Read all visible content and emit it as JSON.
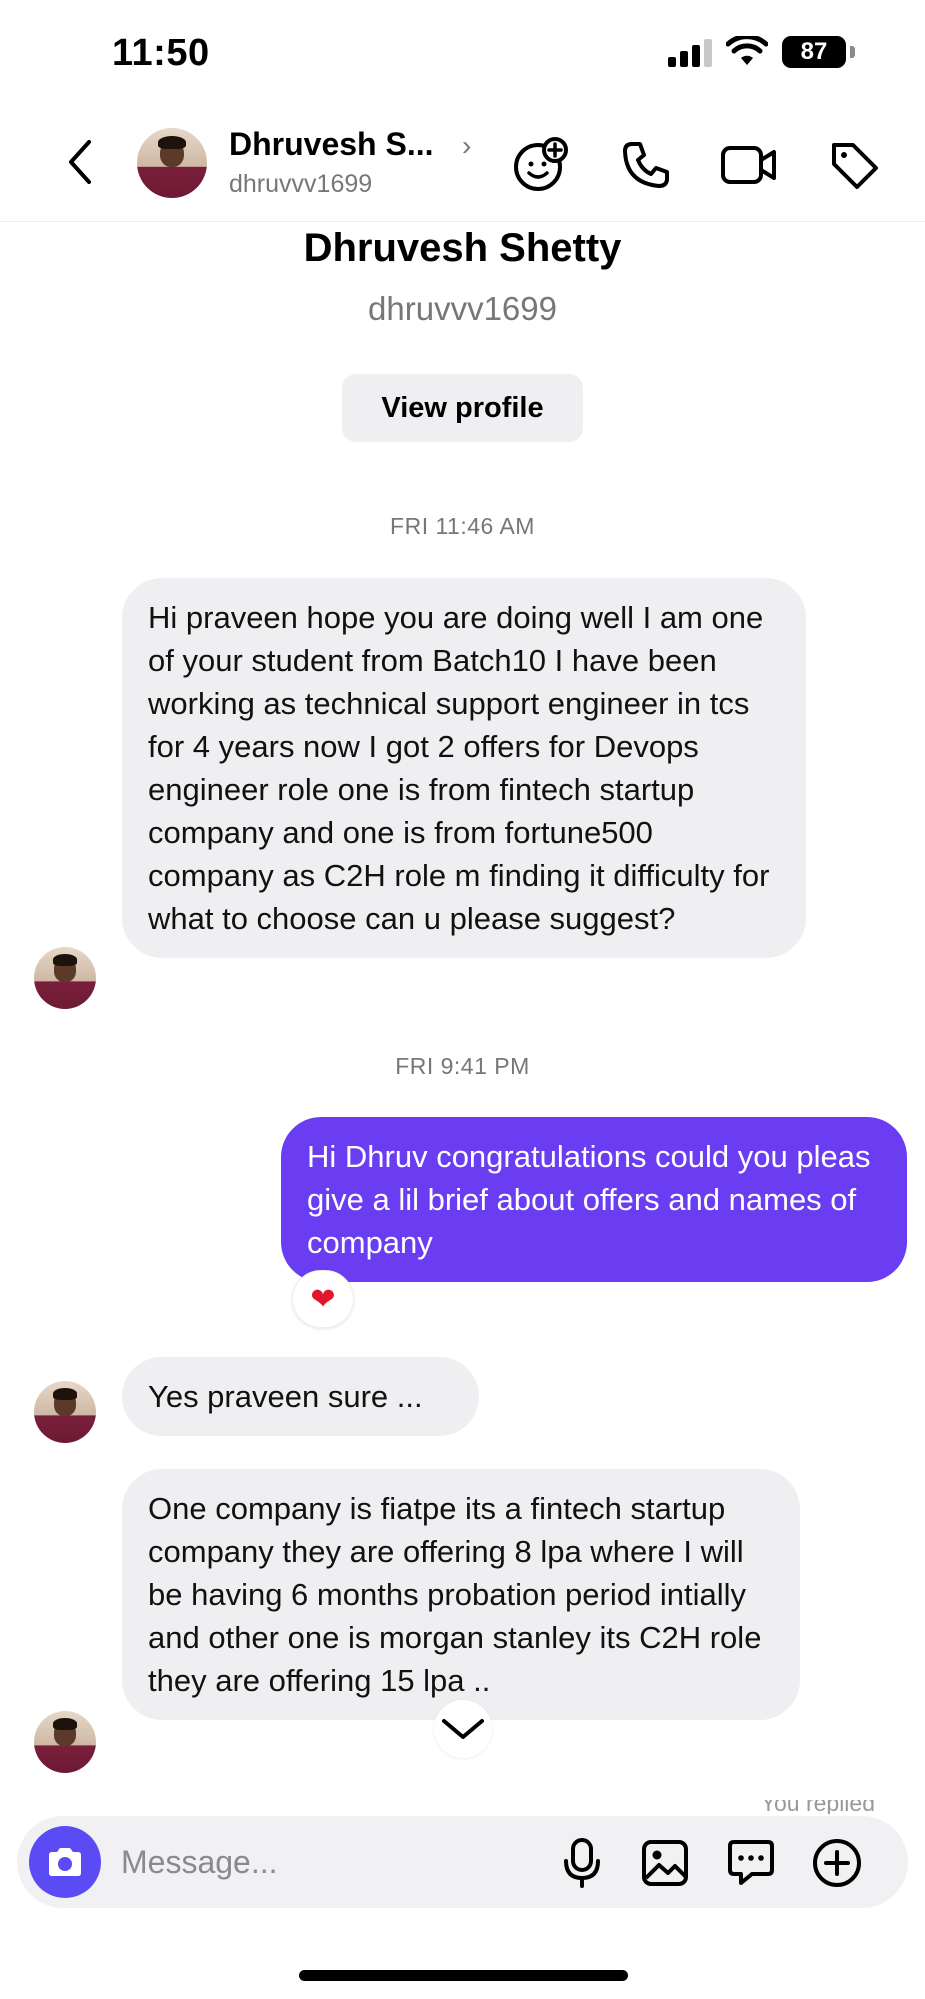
{
  "status_bar": {
    "time": "11:50",
    "battery": "87"
  },
  "header": {
    "name": "Dhruvesh S...",
    "username": "dhruvvv1699"
  },
  "profile": {
    "name": "Dhruvesh Shetty",
    "username": "dhruvvv1699",
    "view_profile_label": "View profile"
  },
  "messages": [
    {
      "timestamp": "FRI 11:46 AM"
    },
    {
      "direction": "in",
      "text": "Hi praveen hope you are doing well I am one of your student from Batch10 I have been working as technical support engineer in tcs for 4 years now I got 2 offers for Devops engineer role one is from fintech startup company and one is from fortune500 company as C2H role m finding it difficulty for what to choose can u please suggest?"
    },
    {
      "timestamp": "FRI 9:41 PM"
    },
    {
      "direction": "out",
      "text": "Hi Dhruv congratulations could you pleas give a lil brief about offers and names of company",
      "reaction": "❤"
    },
    {
      "direction": "in",
      "text": "Yes praveen sure ..."
    },
    {
      "direction": "in",
      "text": "One company is fiatpe its a fintech startup company they are offering 8 lpa where I will be having 6 months probation period intially and other one is morgan stanley its C2H role they are offering 15 lpa .."
    }
  ],
  "replied_peek": "You replied",
  "composer": {
    "placeholder": "Message..."
  },
  "colors": {
    "outgoing_bubble": "#6a3df3",
    "incoming_bubble": "#efeff1",
    "camera_button": "#5b4bf5",
    "reaction": "#e3162c"
  },
  "icons": {
    "header": [
      "chevron-left-icon",
      "chevron-right-icon",
      "sticker-add-icon",
      "phone-icon",
      "video-camera-icon",
      "tag-icon"
    ],
    "composer": [
      "camera-icon",
      "microphone-icon",
      "image-icon",
      "message-bubble-icon",
      "plus-circle-icon"
    ],
    "scroll": "chevron-down-icon"
  }
}
